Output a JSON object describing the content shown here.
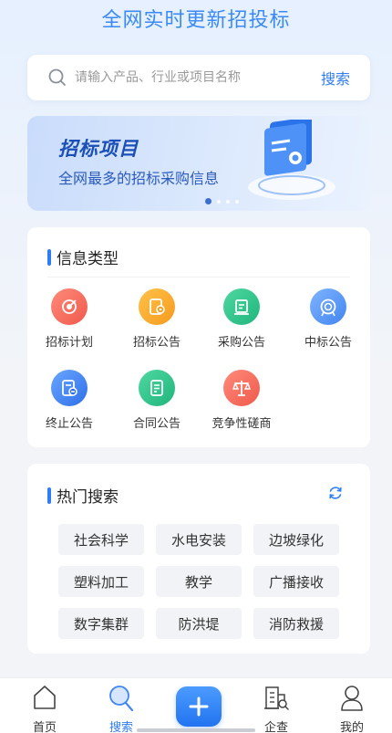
{
  "header": {
    "title": "全网实时更新招投标"
  },
  "search": {
    "placeholder": "请输入产品、行业或项目名称",
    "button_label": "搜索"
  },
  "banner": {
    "title": "招标项目",
    "subtitle": "全网最多的招标采购信息",
    "slide_count": 4,
    "active_slide": 1
  },
  "info_types": {
    "title": "信息类型",
    "items": [
      {
        "label": "招标计划",
        "icon": "target-doc-icon",
        "color": "#f26b5b"
      },
      {
        "label": "招标公告",
        "icon": "target-doc-icon",
        "color": "#f6a623"
      },
      {
        "label": "采购公告",
        "icon": "purchase-doc-icon",
        "color": "#27c28a"
      },
      {
        "label": "中标公告",
        "icon": "award-icon",
        "color": "#4a8ff5"
      },
      {
        "label": "终止公告",
        "icon": "stop-doc-icon",
        "color": "#3b7cf0"
      },
      {
        "label": "合同公告",
        "icon": "contract-icon",
        "color": "#27c28a"
      },
      {
        "label": "竞争性磋商",
        "icon": "scales-icon",
        "color": "#f26b5b"
      }
    ]
  },
  "hot_search": {
    "title": "热门搜索",
    "refresh_icon": "refresh-icon",
    "tags": [
      "社会科学",
      "水电安装",
      "边坡绿化",
      "塑料加工",
      "教学",
      "广播接收",
      "数字集群",
      "防洪堤",
      "消防救援"
    ]
  },
  "tabbar": {
    "tabs": [
      {
        "label": "首页",
        "icon": "home-icon"
      },
      {
        "label": "搜索",
        "icon": "search-icon"
      },
      {
        "label": "企查",
        "icon": "company-search-icon"
      },
      {
        "label": "我的",
        "icon": "user-icon"
      }
    ],
    "active_tab": "搜索",
    "center_button_icon": "plus-icon"
  }
}
